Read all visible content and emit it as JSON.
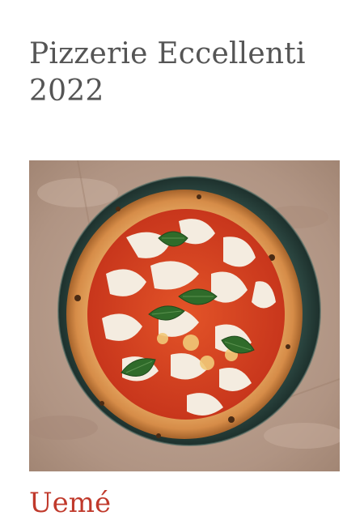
{
  "page": {
    "title": "Pizzerie Eccellenti 2022",
    "hero_image": "pizza-margherita-photo"
  },
  "entry": {
    "name": "Uemé"
  },
  "colors": {
    "title": "#555555",
    "accent": "#c0392b",
    "background": "#ffffff"
  }
}
